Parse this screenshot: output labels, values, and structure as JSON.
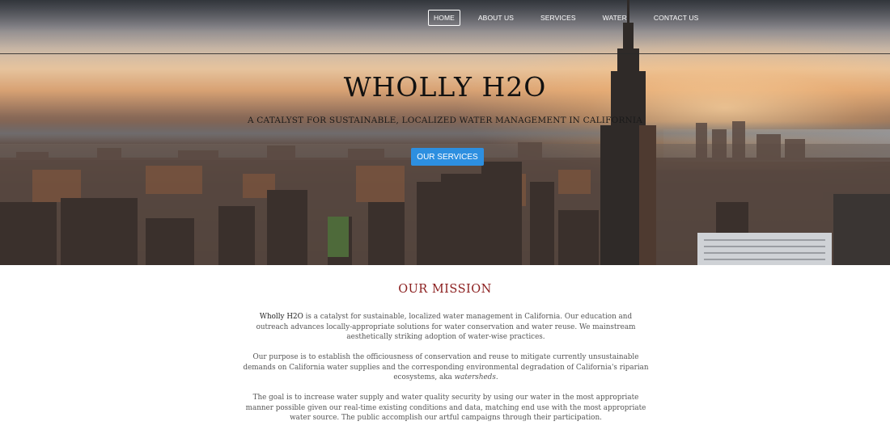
{
  "nav": {
    "items": [
      {
        "label": "HOME",
        "active": true
      },
      {
        "label": "ABOUT US"
      },
      {
        "label": "SERVICES"
      },
      {
        "label": "WATER"
      },
      {
        "label": "CONTACT US"
      }
    ]
  },
  "hero": {
    "title": "WHOLLY H2O",
    "subtitle": "A CATALYST FOR SUSTAINABLE, LOCALIZED WATER MANAGEMENT IN CALIFORNIA",
    "cta_label": "OUR SERVICES",
    "cta_color": "#2d8fe0"
  },
  "mission": {
    "title": "OUR MISSION",
    "title_color": "#8b1e1e",
    "p1_brand": "Wholly H2O",
    "p1_text": " is a catalyst for sustainable, localized water management in California. Our education and outreach advances locally-appropriate solutions for water conservation and water reuse. We mainstream aesthetically striking adoption of water-wise practices.",
    "p2_text": "Our purpose is to establish the officiousness of conservation and reuse to mitigate currently unsustainable demands on California water supplies and the corresponding environmental degradation of California's riparian ecosystems, aka ",
    "p2_em": "watersheds.",
    "p3_text": "The goal is to increase water supply and water quality security by using our water in the most appropriate manner possible given our real-time existing conditions and data, matching end use with the most appropriate water source. The public accomplish our artful campaigns through their participation."
  }
}
